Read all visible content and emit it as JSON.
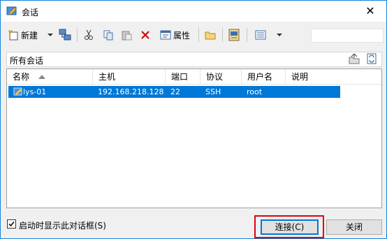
{
  "window": {
    "title": "会话",
    "close_glyph": "✕"
  },
  "toolbar": {
    "new_label": "新建",
    "properties_label": "属性"
  },
  "pathbar": {
    "label": "所有会话"
  },
  "list": {
    "columns": [
      "名称",
      "主机",
      "端口",
      "协议",
      "用户名",
      "说明"
    ],
    "rows": [
      {
        "name": "lys-01",
        "host": "192.168.218.128",
        "port": "22",
        "protocol": "SSH",
        "user": "root",
        "desc": ""
      }
    ]
  },
  "footer": {
    "startup_checkbox_label": "启动时显示此对话框(S)",
    "startup_checked": true,
    "connect_label": "连接(C)",
    "close_label": "关闭"
  },
  "colors": {
    "selection": "#0078d7",
    "focus_ring": "#e0000b",
    "window_border": "#1883d7"
  }
}
